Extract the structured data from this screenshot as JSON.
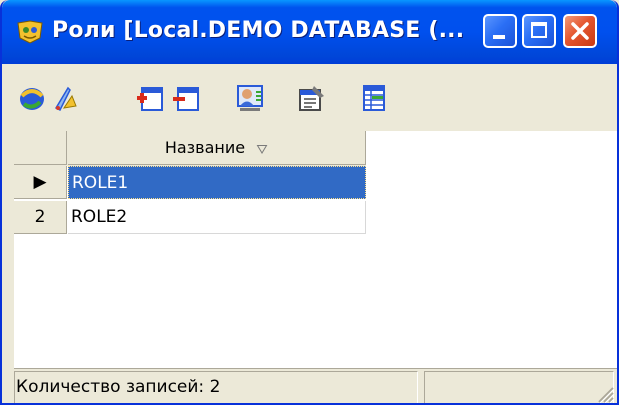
{
  "window": {
    "title": "Роли [Local.DEMO DATABASE (...",
    "icon": "roles-app-icon",
    "controls": {
      "minimize_icon": "minimize-icon",
      "maximize_icon": "maximize-icon",
      "close_icon": "close-icon"
    }
  },
  "toolbar": {
    "buttons": [
      {
        "name": "refresh-button",
        "icon": "refresh-icon"
      },
      {
        "name": "filter-button",
        "icon": "filter-icon"
      },
      {
        "name": "add-button",
        "icon": "add-record-icon"
      },
      {
        "name": "delete-button",
        "icon": "delete-record-icon"
      },
      {
        "name": "users-button",
        "icon": "users-icon"
      },
      {
        "name": "properties-button",
        "icon": "properties-icon"
      },
      {
        "name": "grid-settings-button",
        "icon": "grid-icon"
      }
    ]
  },
  "grid": {
    "columns": [
      {
        "label": "Название",
        "sort": "descending"
      }
    ],
    "rows": [
      {
        "indicator": "▶",
        "name": "ROLE1",
        "selected": true
      },
      {
        "indicator": "2",
        "name": "ROLE2",
        "selected": false
      }
    ]
  },
  "status": {
    "count_text": "Количество записей: 2"
  },
  "colors": {
    "titlebar": "#0050ee",
    "selection": "#316ac5",
    "face": "#ece9d8"
  }
}
